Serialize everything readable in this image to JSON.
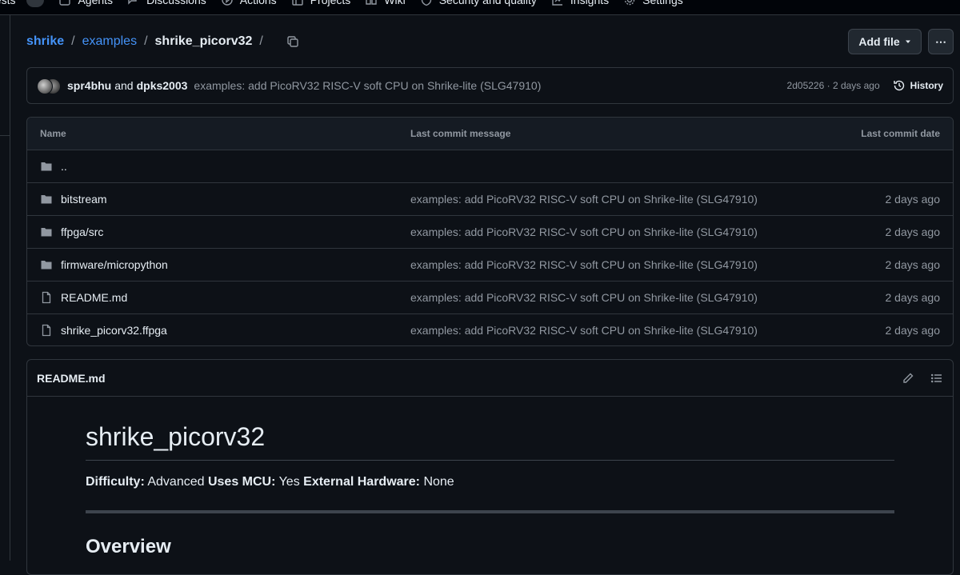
{
  "topnav": {
    "items": [
      {
        "label": "uests",
        "icon": "pull-request-icon"
      },
      {
        "label": "Agents",
        "icon": "agent-icon"
      },
      {
        "label": "Discussions",
        "icon": "discussion-icon"
      },
      {
        "label": "Actions",
        "icon": "play-icon"
      },
      {
        "label": "Projects",
        "icon": "table-icon"
      },
      {
        "label": "Wiki",
        "icon": "book-icon"
      },
      {
        "label": "Security and quality",
        "icon": "shield-icon"
      },
      {
        "label": "Insights",
        "icon": "graph-icon"
      },
      {
        "label": "Settings",
        "icon": "gear-icon"
      }
    ]
  },
  "breadcrumb": {
    "owner": "shrike",
    "folder": "examples",
    "current": "shrike_picorv32",
    "separator": "/"
  },
  "toolbar": {
    "add_file_label": "Add file",
    "more_label": "⋯"
  },
  "commit": {
    "author1": "spr4bhu",
    "and": "and",
    "author2": "dpks2003",
    "message": "examples: add PicoRV32 RISC-V soft CPU on Shrike-lite (SLG47910)",
    "sha": "2d05226",
    "time": "2 days ago",
    "meta_separator": " · ",
    "history_label": "History"
  },
  "table": {
    "headers": {
      "name": "Name",
      "message": "Last commit message",
      "date": "Last commit date"
    },
    "rows": [
      {
        "name": "..",
        "type": "folder",
        "message": "",
        "date": ""
      },
      {
        "name": "bitstream",
        "type": "folder",
        "message": "examples: add PicoRV32 RISC-V soft CPU on Shrike-lite (SLG47910)",
        "date": "2 days ago"
      },
      {
        "name": "ffpga/src",
        "type": "folder",
        "message": "examples: add PicoRV32 RISC-V soft CPU on Shrike-lite (SLG47910)",
        "date": "2 days ago"
      },
      {
        "name": "firmware/micropython",
        "type": "folder",
        "message": "examples: add PicoRV32 RISC-V soft CPU on Shrike-lite (SLG47910)",
        "date": "2 days ago"
      },
      {
        "name": "README.md",
        "type": "file",
        "message": "examples: add PicoRV32 RISC-V soft CPU on Shrike-lite (SLG47910)",
        "date": "2 days ago"
      },
      {
        "name": "shrike_picorv32.ffpga",
        "type": "file",
        "message": "examples: add PicoRV32 RISC-V soft CPU on Shrike-lite (SLG47910)",
        "date": "2 days ago"
      }
    ]
  },
  "readme": {
    "filename": "README.md",
    "title": "shrike_picorv32",
    "difficulty_label": "Difficulty:",
    "difficulty_value": "Advanced",
    "mcu_label": "Uses MCU:",
    "mcu_value": "Yes",
    "hw_label": "External Hardware:",
    "hw_value": "None",
    "section": "Overview"
  },
  "colors": {
    "link": "#4493f8",
    "background": "#0d1117",
    "border": "#30363d",
    "muted": "#9198a1"
  }
}
